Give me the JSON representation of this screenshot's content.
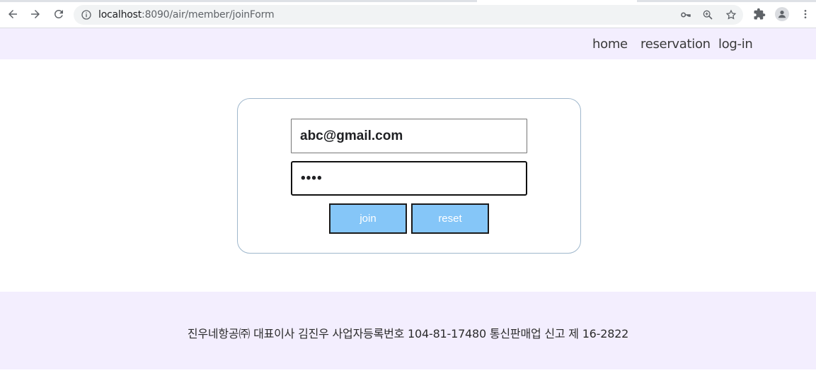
{
  "browser": {
    "url_host": "localhost",
    "url_path": ":8090/air/member/joinForm"
  },
  "header": {
    "nav": [
      {
        "label": "home"
      },
      {
        "label": "reservation"
      },
      {
        "label": "log-in"
      }
    ]
  },
  "form": {
    "email_value": "abc@gmail.com",
    "password_value": "••••",
    "join_label": "join",
    "reset_label": "reset"
  },
  "footer": {
    "text": "진우네항공㈜ 대표이사 김진우 사업자등록번호 104-81-17480 통신판매업 신고 제 16-2822"
  },
  "colors": {
    "header_bg": "#f3eefe",
    "footer_bg": "#f3eefe",
    "button_bg": "#85c6f8",
    "card_border": "#9fb7cc"
  }
}
